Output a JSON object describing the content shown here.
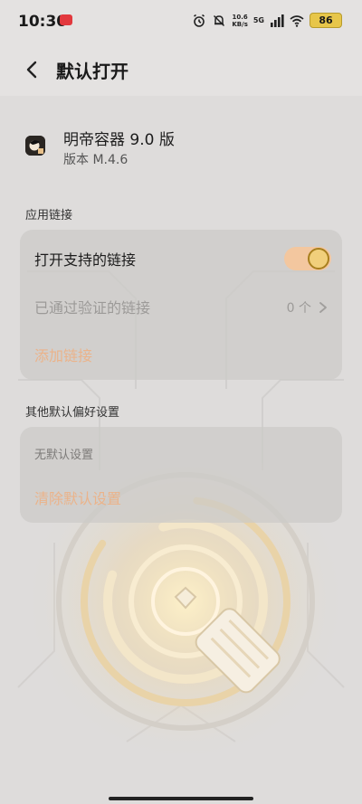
{
  "status_bar": {
    "time": "10:30",
    "speed_value": "10.6",
    "speed_unit": "KB/s",
    "network": "5G",
    "battery": "86",
    "icons": [
      "app-notification-icon",
      "alarm-icon",
      "mute-bell-icon",
      "signal-icon",
      "wifi-icon",
      "battery-icon"
    ]
  },
  "header": {
    "title": "默认打开"
  },
  "app": {
    "name": "明帝容器 9.0 版",
    "version": "版本 M.4.6"
  },
  "links_section": {
    "label": "应用链接",
    "open_supported_label": "打开支持的链接",
    "open_supported_enabled": true,
    "verified_label": "已通过验证的链接",
    "verified_count": "0 个",
    "add_link_label": "添加链接"
  },
  "defaults_section": {
    "label": "其他默认偏好设置",
    "no_defaults_text": "无默认设置",
    "clear_defaults_label": "清除默认设置"
  },
  "colors": {
    "accent": "#f3c79f",
    "accent_text": "#ebb38a",
    "knob_border": "#a87f1d"
  }
}
